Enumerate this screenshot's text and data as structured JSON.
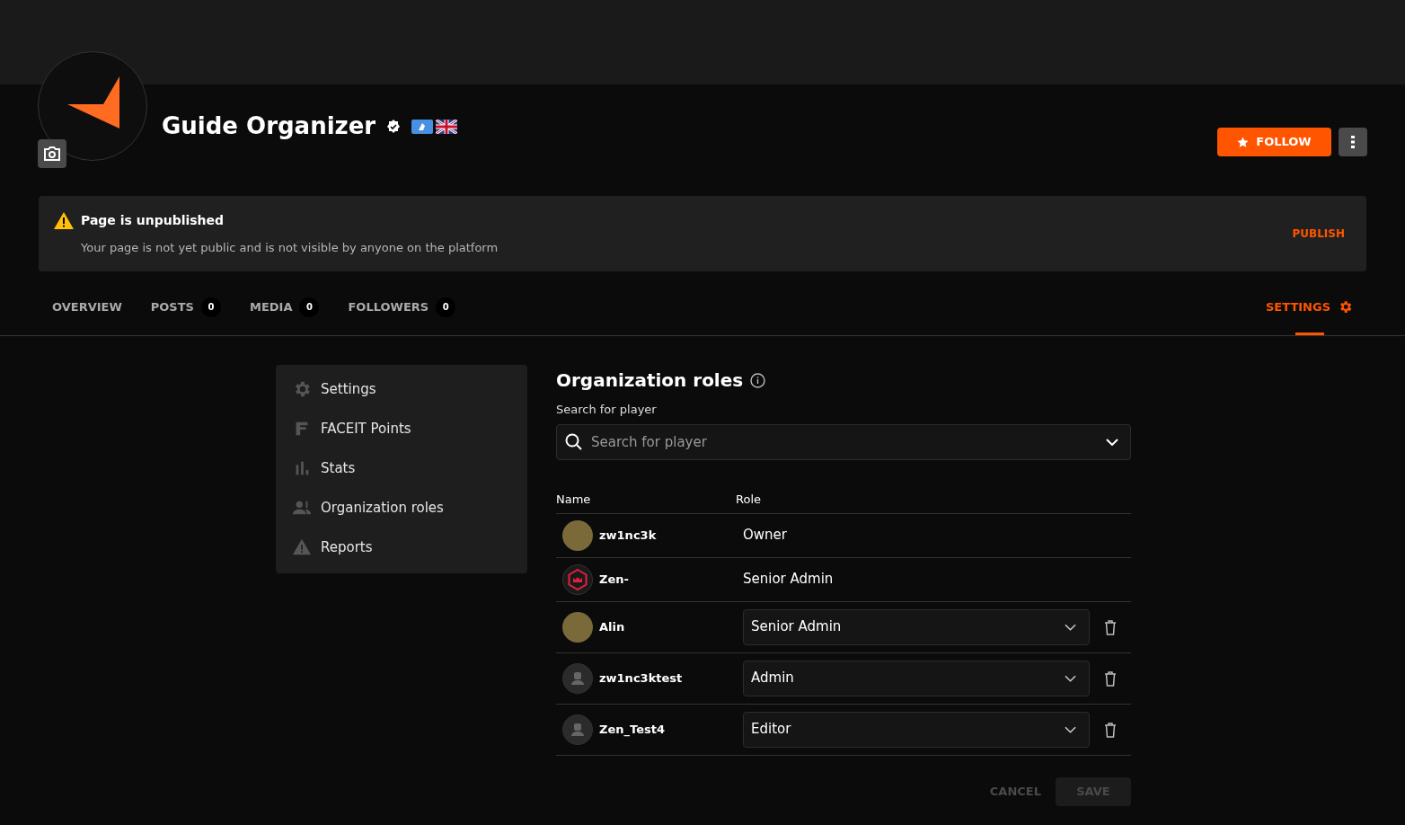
{
  "profile": {
    "name": "Guide Organizer",
    "follow_button": "FOLLOW"
  },
  "notice": {
    "title": "Page is unpublished",
    "message": "Your page is not yet public and is not visible by anyone on the platform",
    "action": "PUBLISH"
  },
  "tabs": [
    {
      "label": "OVERVIEW",
      "kind": "plain",
      "selected": false
    },
    {
      "label": "POSTS",
      "count": "0",
      "kind": "plain",
      "selected": false
    },
    {
      "label": "MEDIA",
      "count": "0",
      "kind": "plain",
      "selected": false
    },
    {
      "label": "FOLLOWERS",
      "count": "0",
      "kind": "plain",
      "selected": false
    },
    {
      "label": "SETTINGS",
      "kind": "settings",
      "selected": true
    }
  ],
  "sidebar": {
    "items": [
      {
        "label": "Settings",
        "kind": "gear"
      },
      {
        "label": "FACEIT Points",
        "kind": "points"
      },
      {
        "label": "Stats",
        "kind": "stats"
      },
      {
        "label": "Organization roles",
        "kind": "people"
      },
      {
        "label": "Reports",
        "kind": "warning"
      }
    ]
  },
  "roles": {
    "title": "Organization roles",
    "search_label": "Search for player",
    "search": {
      "placeholder": "Search for player"
    },
    "columns": [
      "Name",
      "Role"
    ],
    "rows": [
      {
        "name": "zw1nc3k",
        "role": "Owner",
        "kind": "fixed",
        "avatar": {
          "kind": "photo"
        }
      },
      {
        "name": "Zen-",
        "role": "Senior Admin",
        "kind": "fixed",
        "avatar": {
          "kind": "badge"
        }
      },
      {
        "name": "Alin",
        "role": "Senior Admin",
        "kind": "select",
        "avatar": {
          "kind": "photo"
        }
      },
      {
        "name": "zw1nc3ktest",
        "role": "Admin",
        "kind": "select",
        "avatar": {
          "kind": "default"
        }
      },
      {
        "name": "Zen_Test4",
        "role": "Editor",
        "kind": "select",
        "avatar": {
          "kind": "default"
        }
      }
    ],
    "buttons": [
      {
        "label": "CANCEL",
        "kind": "text",
        "disabled": true
      },
      {
        "label": "SAVE",
        "kind": "filled",
        "disabled": true
      }
    ]
  }
}
